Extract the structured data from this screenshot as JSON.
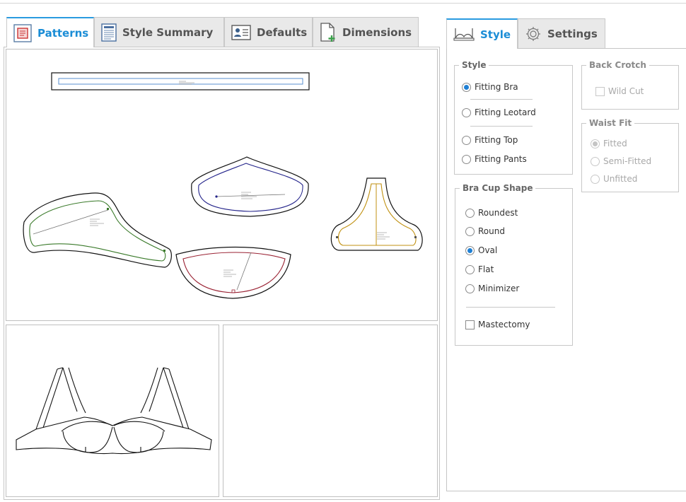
{
  "left_tabs": [
    {
      "label": "Patterns",
      "icon": "patterns-icon",
      "active": true
    },
    {
      "label": "Style Summary",
      "icon": "document-icon",
      "active": false
    },
    {
      "label": "Defaults",
      "icon": "user-card-icon",
      "active": false
    },
    {
      "label": "Dimensions",
      "icon": "add-page-icon",
      "active": false
    }
  ],
  "right_tabs": [
    {
      "label": "Style",
      "icon": "bra-icon",
      "active": true
    },
    {
      "label": "Settings",
      "icon": "gear-icon",
      "active": false
    }
  ],
  "style_group": {
    "legend": "Style",
    "options": [
      "Fitting Bra",
      "Fitting Leotard",
      "Fitting Top",
      "Fitting Pants"
    ],
    "selected": "Fitting Bra"
  },
  "cup_group": {
    "legend": "Bra Cup Shape",
    "options": [
      "Roundest",
      "Round",
      "Oval",
      "Flat",
      "Minimizer"
    ],
    "selected": "Oval",
    "mastectomy_label": "Mastectomy",
    "mastectomy_checked": false
  },
  "back_crotch": {
    "legend": "Back Crotch",
    "wild_cut_label": "Wild Cut",
    "enabled": false
  },
  "waist_fit": {
    "legend": "Waist Fit",
    "options": [
      "Fitted",
      "Semi-Fitted",
      "Unfitted"
    ],
    "selected": "Fitted",
    "enabled": false
  },
  "colors": {
    "accent": "#1b8dd6",
    "piece_green": "#3a7a2a",
    "piece_navy": "#23238a",
    "piece_red": "#9a2233",
    "piece_gold": "#c09010",
    "band_blue": "#5a8fcf"
  }
}
